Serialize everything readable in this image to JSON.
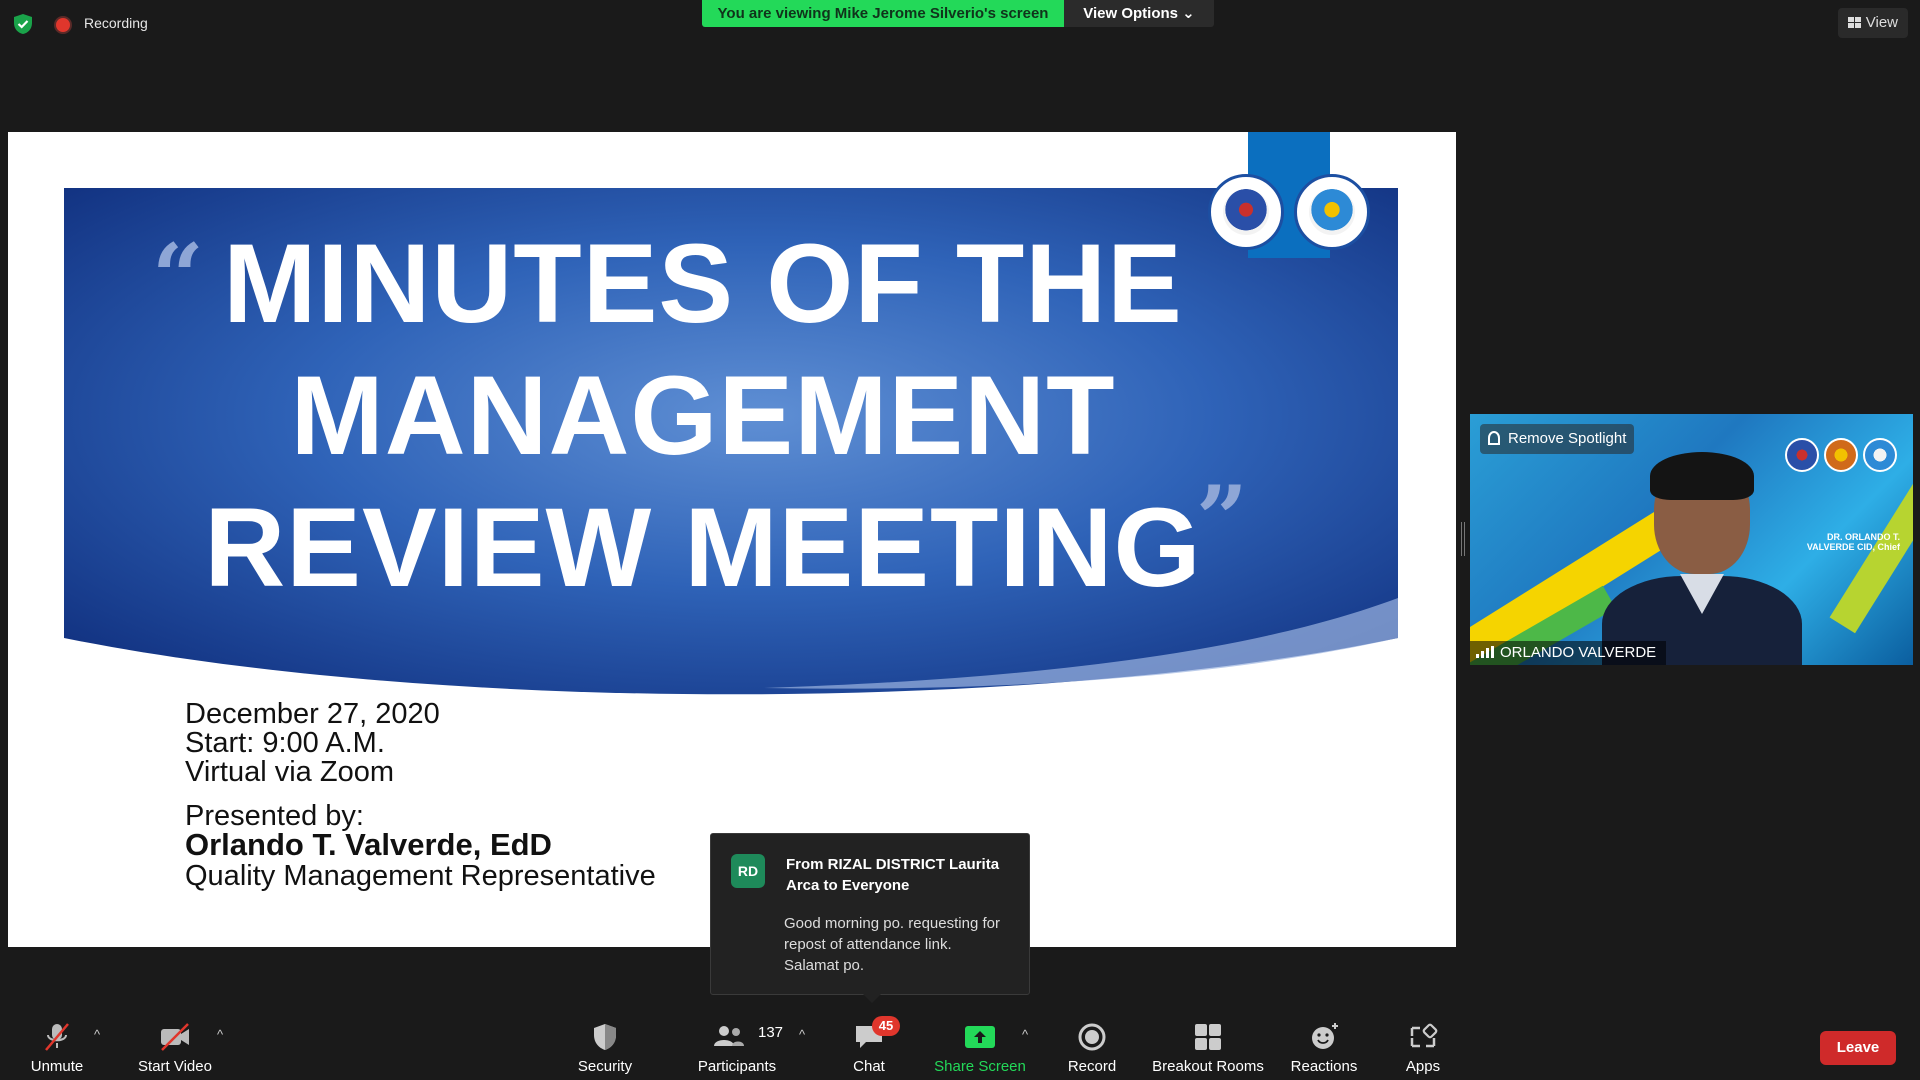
{
  "top_bar": {
    "recording_label": "Recording",
    "viewing_banner": "You are viewing Mike Jerome Silverio's screen",
    "view_options_label": "View Options",
    "view_label": "View"
  },
  "slide": {
    "title_lines": [
      "MINUTES OF THE",
      "MANAGEMENT",
      "REVIEW MEETING"
    ],
    "quote_open": "“",
    "quote_close": "”",
    "date": "December 27, 2020",
    "start": "Start:  9:00 A.M.",
    "venue": "Virtual via Zoom",
    "presented_by": "Presented by:",
    "presenter_name": "Orlando T. Valverde, EdD",
    "presenter_role": "Quality Management Representative"
  },
  "chat_popup": {
    "avatar_initials": "RD",
    "from": "From RIZAL DISTRICT Laurita Arca to Everyone",
    "message": "Good morning po. requesting for repost of attendance link. Salamat po."
  },
  "participant_tile": {
    "spotlight_label": "Remove Spotlight",
    "name": "ORLANDO VALVERDE",
    "caption": "DR. ORLANDO T. VALVERDE CID, Chief"
  },
  "toolbar": {
    "unmute": "Unmute",
    "start_video": "Start Video",
    "security": "Security",
    "participants": "Participants",
    "participants_count": "137",
    "chat": "Chat",
    "chat_badge": "45",
    "share_screen": "Share Screen",
    "record": "Record",
    "breakout_rooms": "Breakout Rooms",
    "reactions": "Reactions",
    "apps": "Apps",
    "leave": "Leave"
  },
  "colors": {
    "banner_green": "#23d959",
    "leave_red": "#cf2a2a",
    "slide_blue": "#1d4fa8",
    "badge_red": "#e0362c"
  }
}
